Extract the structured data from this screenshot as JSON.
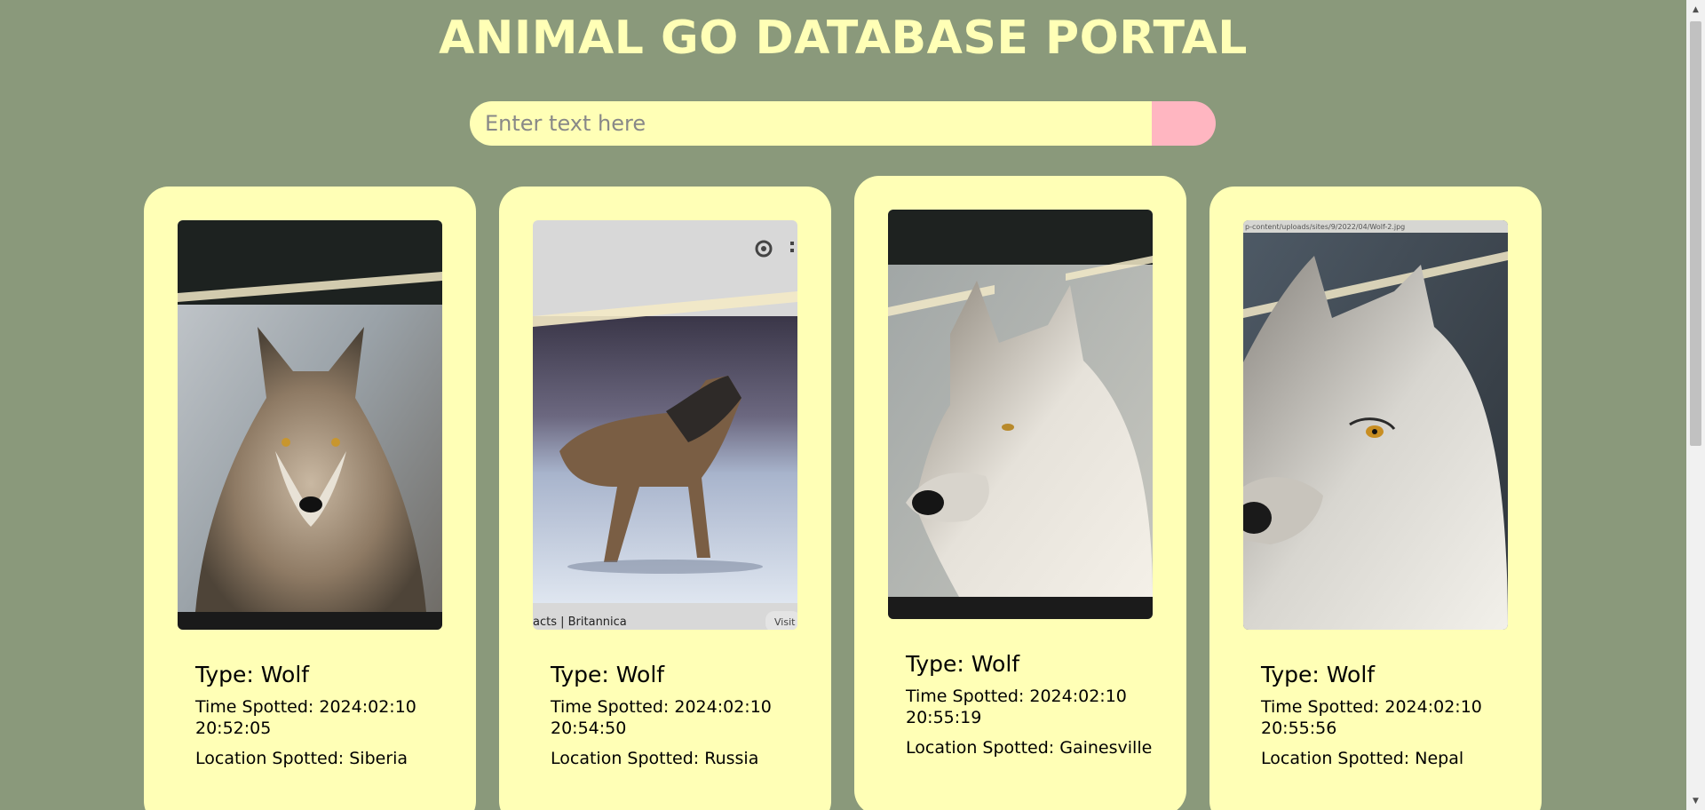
{
  "header": {
    "title": "ANIMAL GO DATABASE PORTAL"
  },
  "search": {
    "placeholder": "Enter text here",
    "value": "",
    "button_color": "#ffb6c1"
  },
  "colors": {
    "background": "#8a997b",
    "card": "#ffffb6",
    "title": "#ffffb6"
  },
  "cards": [
    {
      "type": "Type: Wolf",
      "time": "Time Spotted: 2024:02:10 20:52:05",
      "location": "Location Spotted: Siberia"
    },
    {
      "type": "Type: Wolf",
      "time": "Time Spotted: 2024:02:10 20:54:50",
      "location": "Location Spotted: Russia",
      "photo_caption": "acts | Britannica",
      "photo_button": "Visit"
    },
    {
      "type": "Type: Wolf",
      "time": "Time Spotted: 2024:02:10 20:55:19",
      "location": "Location Spotted: Gainesville"
    },
    {
      "type": "Type: Wolf",
      "time": "Time Spotted: 2024:02:10 20:55:56",
      "location": "Location Spotted: Nepal",
      "photo_caption": "p-content/uploads/sites/9/2022/04/Wolf-2.jpg"
    }
  ]
}
